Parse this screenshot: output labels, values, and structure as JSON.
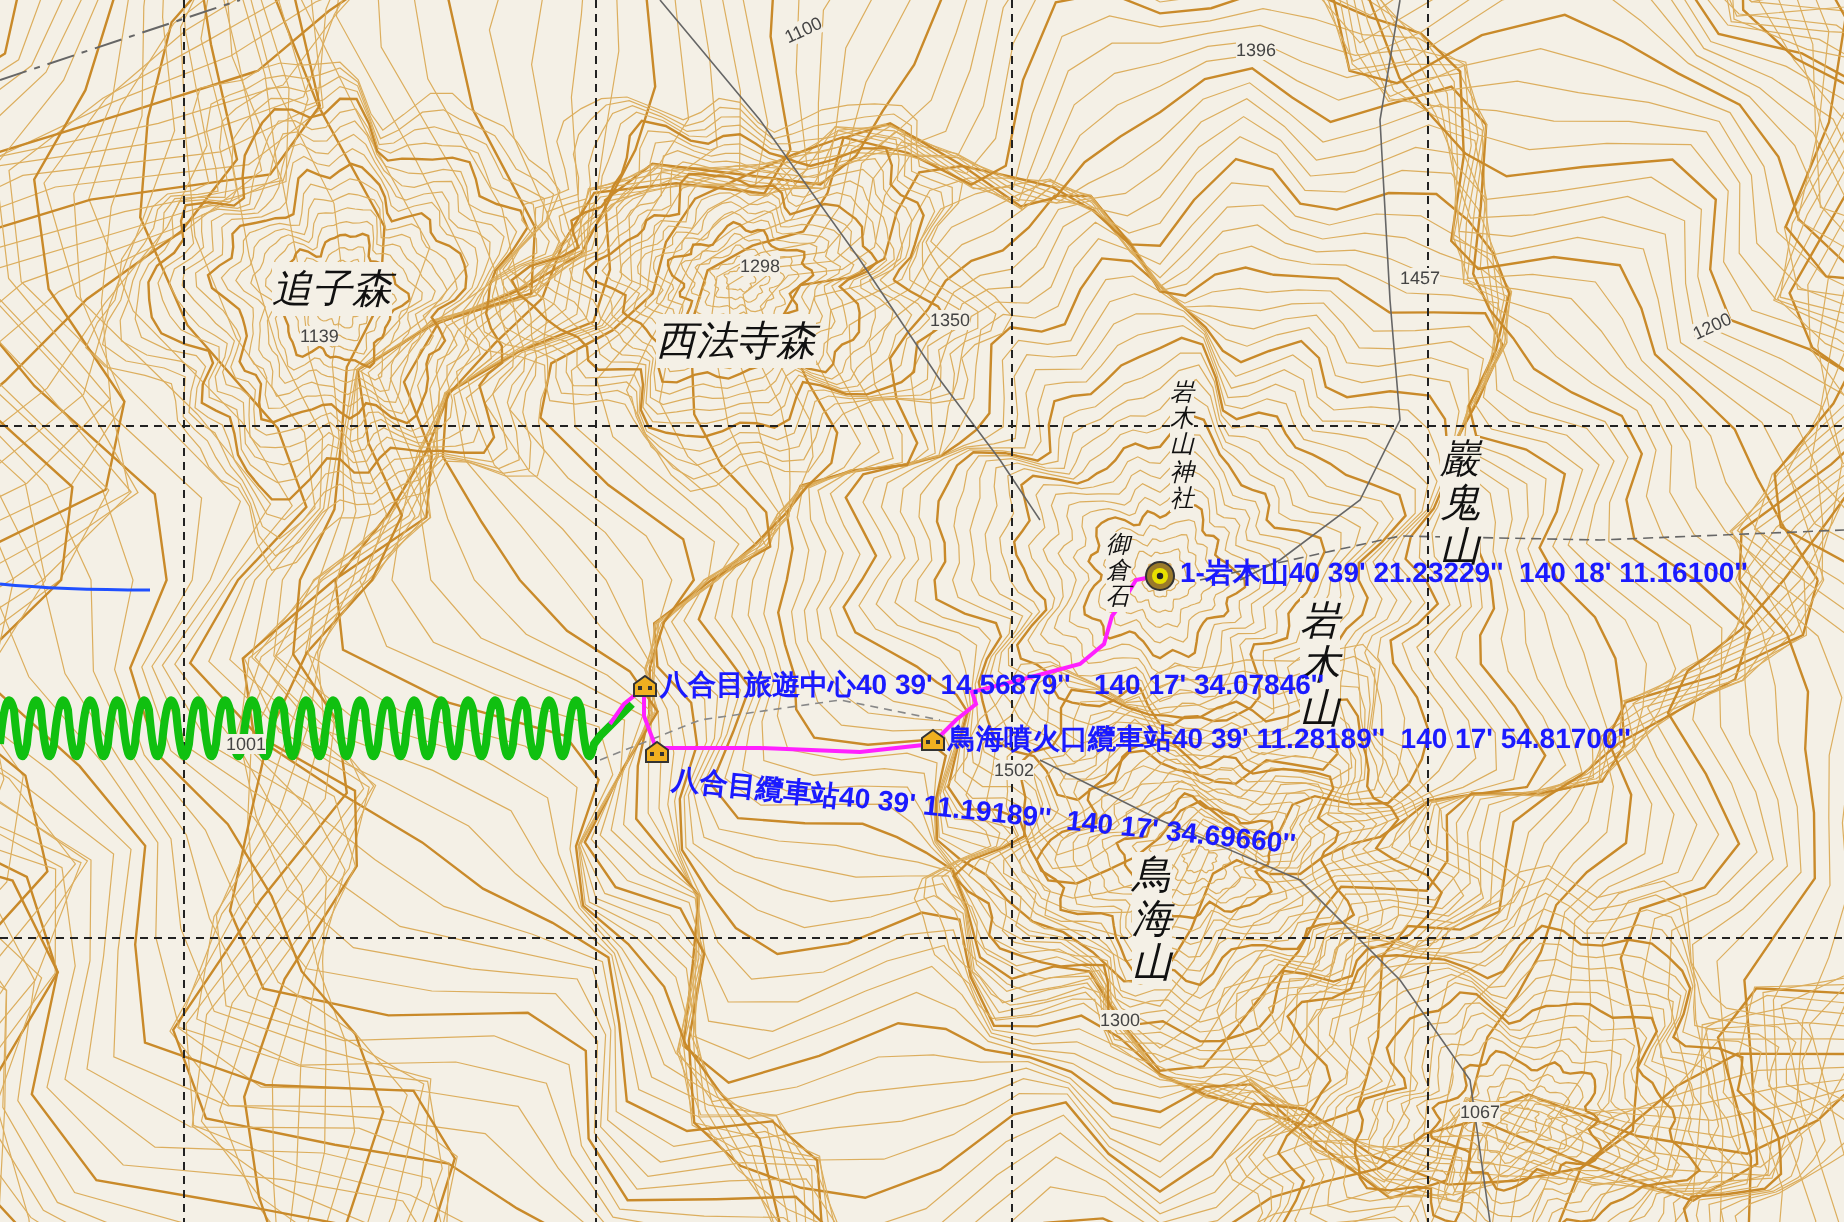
{
  "map": {
    "elevations": [
      {
        "text": "1396"
      },
      {
        "text": "1100"
      },
      {
        "text": "1298"
      },
      {
        "text": "1139"
      },
      {
        "text": "1350"
      },
      {
        "text": "1457"
      },
      {
        "text": "1200"
      },
      {
        "text": "1001"
      },
      {
        "text": "1502"
      },
      {
        "text": "1300"
      },
      {
        "text": "1067"
      }
    ],
    "places": [
      {
        "text": "追子森",
        "kind": "horizontal"
      },
      {
        "text": "西法寺森",
        "kind": "horizontal"
      },
      {
        "text": "岩木山神社",
        "kind": "vertical-small"
      },
      {
        "text": "御倉石",
        "kind": "vertical-small"
      },
      {
        "text": "岩木山",
        "kind": "vertical"
      },
      {
        "text": "巖鬼山",
        "kind": "vertical"
      },
      {
        "text": "鳥海山",
        "kind": "vertical"
      }
    ],
    "waypoints": [
      {
        "kind": "summit",
        "label": "1-岩木山40 39' 21.23229''  140 18' 11.16100''"
      },
      {
        "kind": "hut",
        "label": "八合目旅遊中心40 39' 14.56879''   140 17' 34.07846''"
      },
      {
        "kind": "hut",
        "label": "鳥海噴火口纜車站40 39' 11.28189''  140 17' 54.81700''"
      },
      {
        "kind": "hut",
        "label": "八合目纜車站40 39' 11.19189''  140 17' 34.69660''"
      }
    ]
  }
}
